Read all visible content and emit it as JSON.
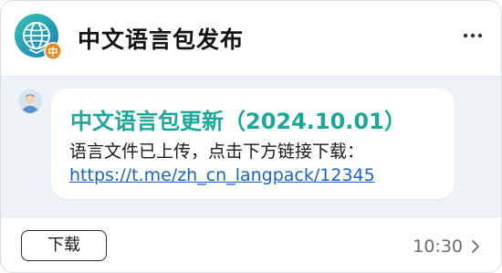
{
  "header": {
    "title": "中文语言包发布",
    "logo_icon": "globe-icon",
    "logo_badge": "中",
    "more_icon": "more-dots-icon"
  },
  "message": {
    "avatar_icon": "user-avatar-icon",
    "title": "中文语言包更新（2024.10.01）",
    "body": "语言文件已上传，点击下方链接下载：",
    "link": "https://t.me/zh_cn_langpack/12345"
  },
  "footer": {
    "download_label": "下载",
    "time": "10:30",
    "chevron_icon": "chevron-right-icon"
  },
  "colors": {
    "accent": "#1ba89b",
    "link": "#1a62c6",
    "badge": "#e58a1f"
  }
}
